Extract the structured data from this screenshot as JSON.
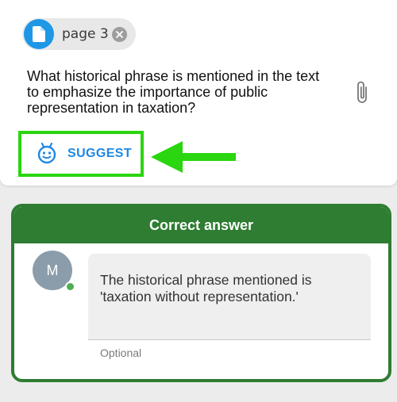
{
  "attachment_chip": {
    "label": "page 3",
    "icon": "document-icon",
    "close_icon": "close-circle-icon"
  },
  "question": {
    "text": "What historical phrase is mentioned in the text to emphasize the importance of public representation in taxation?",
    "attach_icon": "paperclip-icon"
  },
  "suggest": {
    "label": "SUGGEST",
    "icon": "robot-face-icon",
    "highlight_color": "#2ad60f"
  },
  "annotation": {
    "arrow_icon": "arrow-left-icon",
    "color": "#2ad60f"
  },
  "answer_card": {
    "header": "Correct answer",
    "header_color": "#2e7d32",
    "avatar_initial": "M",
    "answer_text": "The historical phrase mentioned is 'taxation without representation.'",
    "helper_text": "Optional"
  }
}
